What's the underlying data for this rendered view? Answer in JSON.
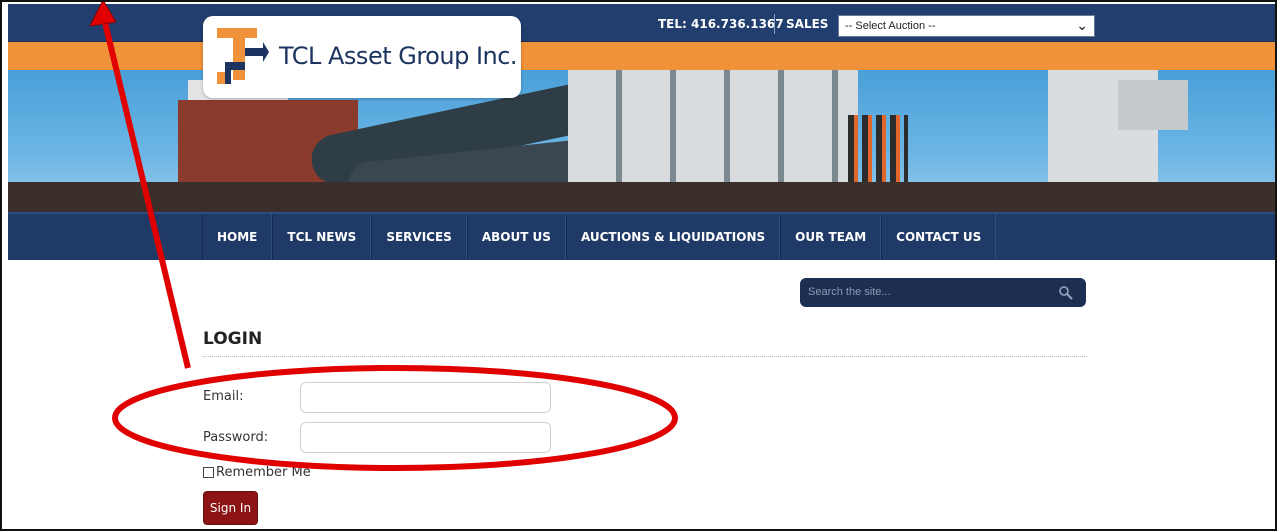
{
  "header": {
    "tel": "TEL: 416.736.1367",
    "sales_label": "SALES",
    "auction_select": {
      "selected": "-- Select Auction --"
    }
  },
  "logo": {
    "name": "TCL Asset Group Inc."
  },
  "nav": {
    "items": [
      {
        "label": "HOME"
      },
      {
        "label": "TCL NEWS"
      },
      {
        "label": "SERVICES"
      },
      {
        "label": "ABOUT US"
      },
      {
        "label": "AUCTIONS & LIQUIDATIONS"
      },
      {
        "label": "OUR TEAM"
      },
      {
        "label": "CONTACT US"
      }
    ]
  },
  "search": {
    "placeholder": "Search the site..."
  },
  "login": {
    "title": "LOGIN",
    "email_label": "Email:",
    "email_value": "",
    "password_label": "Password:",
    "password_value": "",
    "remember_label": "Remember Me",
    "remember_checked": false,
    "signin_label": "Sign In"
  },
  "colors": {
    "topbar": "#223e6e",
    "orange_band": "#f0923a",
    "nav": "#203a68",
    "signin": "#8c1414",
    "annotation": "#e00000"
  },
  "icons": {
    "search": "magnifier-icon",
    "select": "chevron-down-icon",
    "logo": "tcl-logo-mark"
  }
}
